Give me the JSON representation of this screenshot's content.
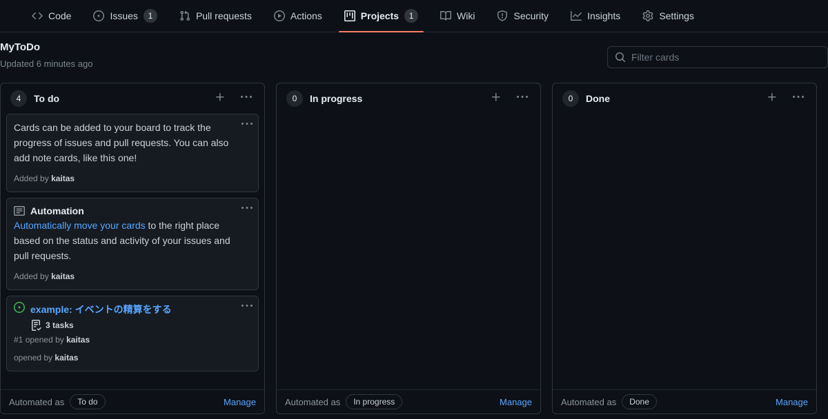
{
  "nav": {
    "items": [
      {
        "label": "Code",
        "icon": "code-icon",
        "count": null,
        "active": false
      },
      {
        "label": "Issues",
        "icon": "issue-opened-icon",
        "count": "1",
        "active": false
      },
      {
        "label": "Pull requests",
        "icon": "git-pull-request-icon",
        "count": null,
        "active": false
      },
      {
        "label": "Actions",
        "icon": "play-icon",
        "count": null,
        "active": false
      },
      {
        "label": "Projects",
        "icon": "project-icon",
        "count": "1",
        "active": true
      },
      {
        "label": "Wiki",
        "icon": "book-icon",
        "count": null,
        "active": false
      },
      {
        "label": "Security",
        "icon": "shield-icon",
        "count": null,
        "active": false
      },
      {
        "label": "Insights",
        "icon": "graph-icon",
        "count": null,
        "active": false
      },
      {
        "label": "Settings",
        "icon": "gear-icon",
        "count": null,
        "active": false
      }
    ],
    "active_underline_color": "#f78166"
  },
  "project": {
    "title": "MyToDo",
    "updated": "Updated 6 minutes ago"
  },
  "search": {
    "placeholder": "Filter cards",
    "value": "",
    "icon": "search-icon"
  },
  "board": {
    "columns": [
      {
        "name": "To do",
        "count": "4",
        "add_icon": "plus-icon",
        "menu_icon": "kebab-horizontal-icon",
        "footer": {
          "prefix": "Automated as",
          "pill": "To do",
          "manage": "Manage"
        },
        "cards": [
          {
            "type": "note",
            "body": "Cards can be added to your board to track the progress of issues and pull requests. You can also add note cards, like this one!",
            "meta_prefix": "Added by",
            "meta_user": "kaitas",
            "menu_icon": "kebab-horizontal-icon"
          },
          {
            "type": "note-titled",
            "icon": "note-icon",
            "title": "Automation",
            "body_link": "Automatically move your cards",
            "body_rest": " to the right place based on the status and activity of your issues and pull requests.",
            "meta_prefix": "Added by",
            "meta_user": "kaitas",
            "menu_icon": "kebab-horizontal-icon"
          },
          {
            "type": "issue",
            "icon": "issue-opened-icon",
            "title": "example: イベントの精算をする",
            "tasks_icon": "tasklist-icon",
            "tasks": "3 tasks",
            "meta_number": "#1",
            "meta_prefix": "opened by",
            "meta_user": "kaitas",
            "menu_icon": "kebab-horizontal-icon"
          }
        ]
      },
      {
        "name": "In progress",
        "count": "0",
        "add_icon": "plus-icon",
        "menu_icon": "kebab-horizontal-icon",
        "footer": {
          "prefix": "Automated as",
          "pill": "In progress",
          "manage": "Manage"
        },
        "cards": []
      },
      {
        "name": "Done",
        "count": "0",
        "add_icon": "plus-icon",
        "menu_icon": "kebab-horizontal-icon",
        "footer": {
          "prefix": "Automated as",
          "pill": "Done",
          "manage": "Manage"
        },
        "cards": []
      }
    ]
  },
  "colors": {
    "page_bg": "#0d1117",
    "card_bg": "#161b22",
    "border": "#30363d",
    "link": "#58a6ff",
    "accent": "#f78166",
    "open_issue_green": "#3fb950",
    "muted_text": "#8b949e"
  }
}
